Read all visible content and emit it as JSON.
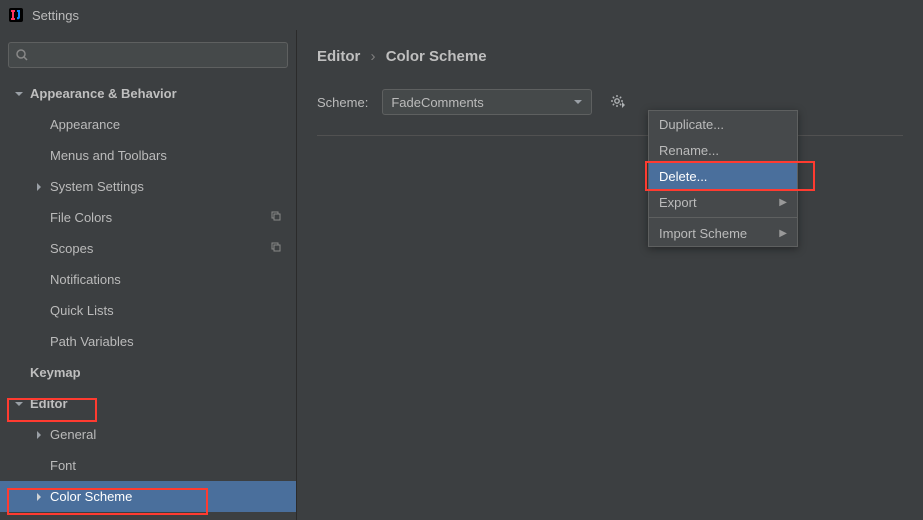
{
  "window": {
    "title": "Settings"
  },
  "search": {
    "placeholder": ""
  },
  "sidebar": {
    "items": [
      {
        "label": "Appearance & Behavior"
      },
      {
        "label": "Appearance"
      },
      {
        "label": "Menus and Toolbars"
      },
      {
        "label": "System Settings"
      },
      {
        "label": "File Colors"
      },
      {
        "label": "Scopes"
      },
      {
        "label": "Notifications"
      },
      {
        "label": "Quick Lists"
      },
      {
        "label": "Path Variables"
      },
      {
        "label": "Keymap"
      },
      {
        "label": "Editor"
      },
      {
        "label": "General"
      },
      {
        "label": "Font"
      },
      {
        "label": "Color Scheme"
      }
    ]
  },
  "breadcrumb": {
    "part1": "Editor",
    "sep": "›",
    "part2": "Color Scheme"
  },
  "scheme": {
    "label": "Scheme:",
    "value": "FadeComments"
  },
  "popup": {
    "duplicate": "Duplicate...",
    "rename": "Rename...",
    "delete": "Delete...",
    "export": "Export",
    "import": "Import Scheme"
  }
}
